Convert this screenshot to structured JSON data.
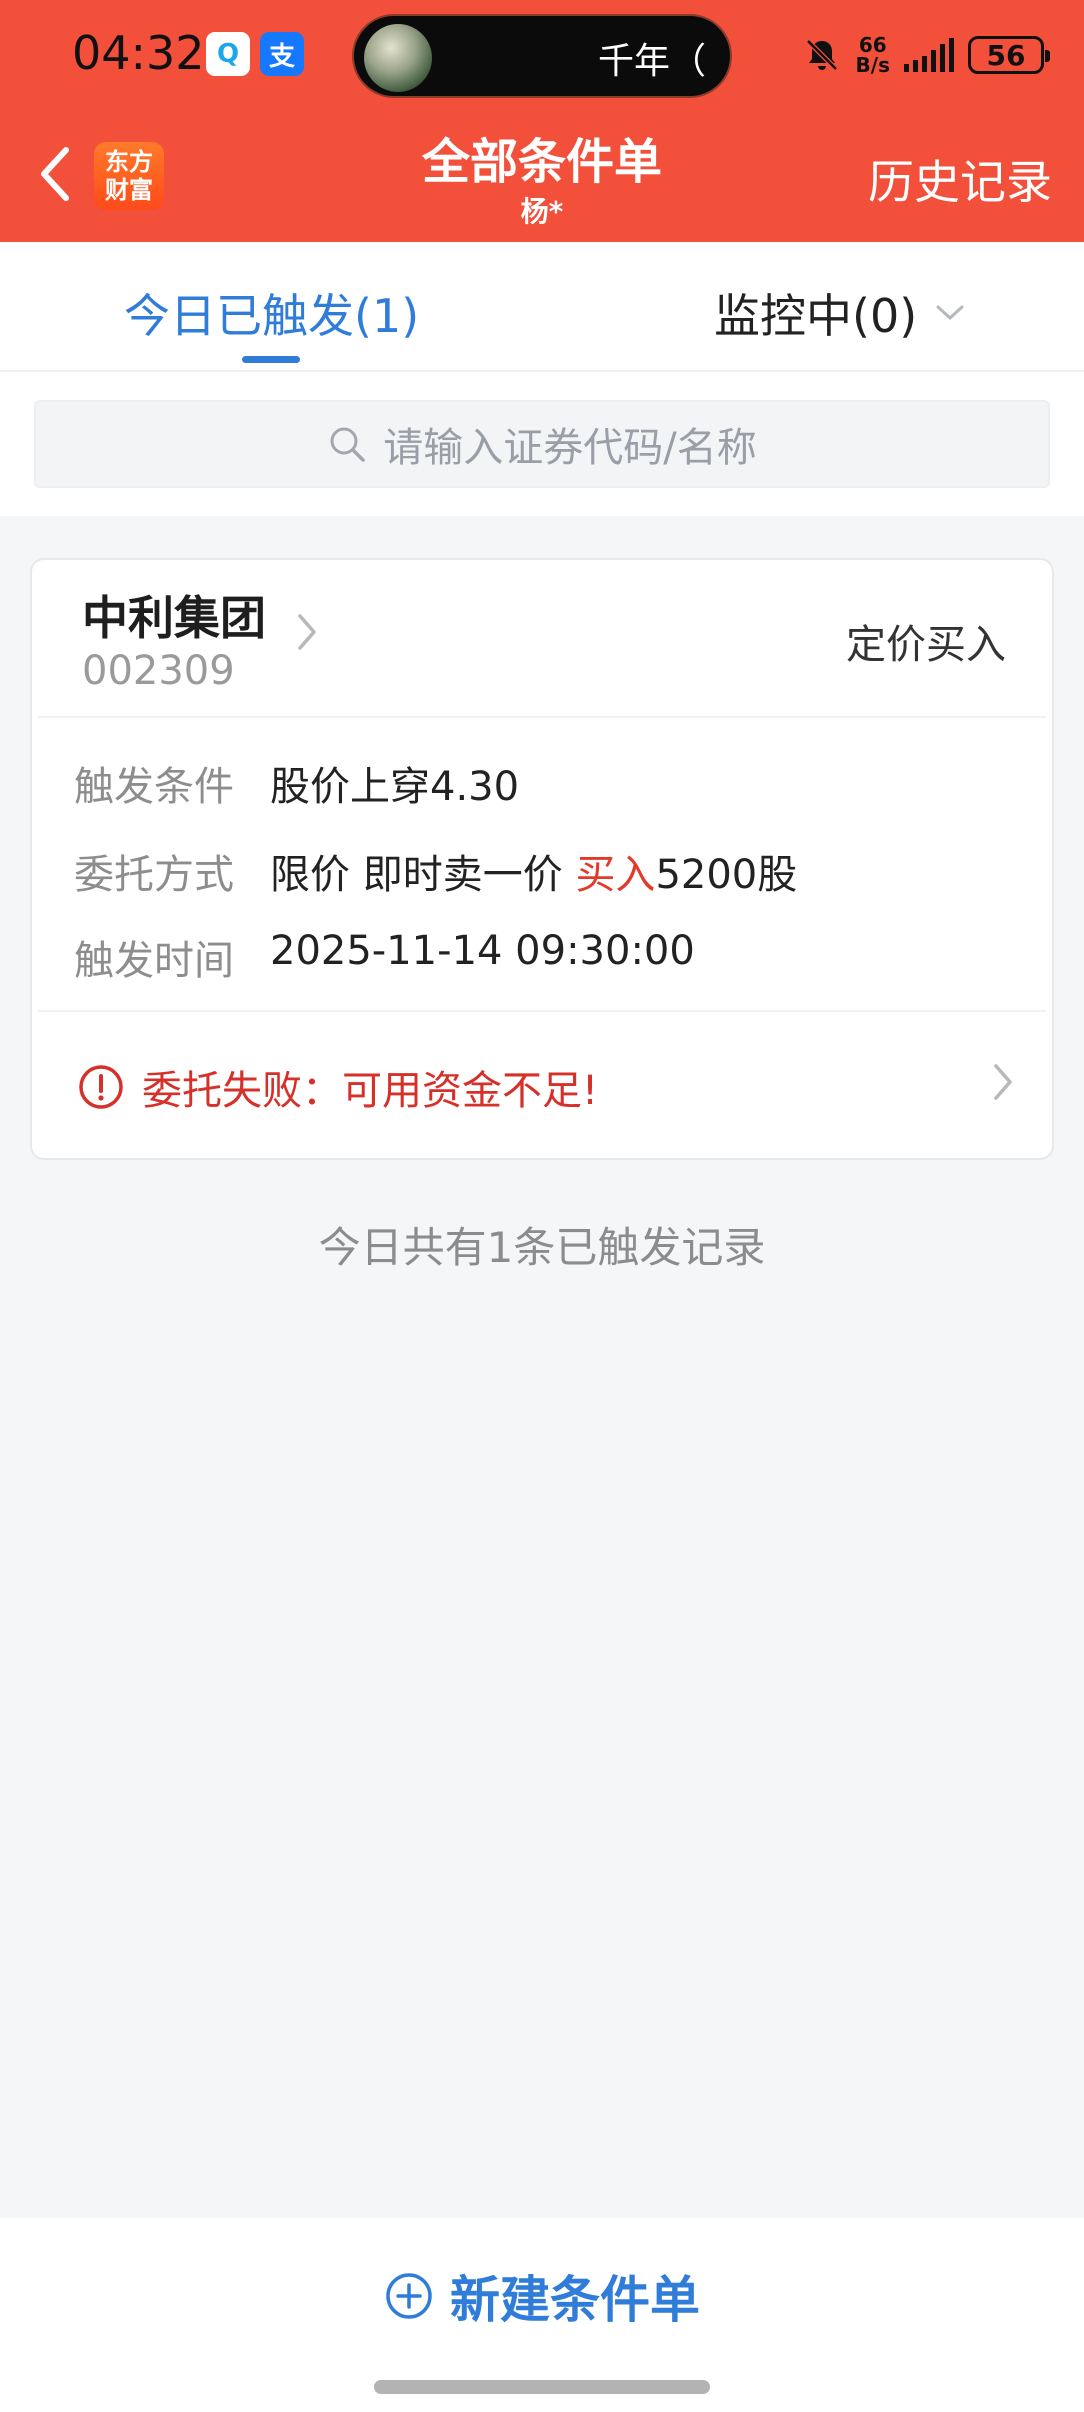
{
  "status_bar": {
    "time": "04:32",
    "qq_icon_glyph": "Q",
    "alipay_icon_glyph": "支",
    "island_text": "千年（",
    "net_speed_value": "66",
    "net_speed_unit": "B/s",
    "battery": "56"
  },
  "header": {
    "logo_line1": "东方",
    "logo_line2": "财富",
    "title": "全部条件单",
    "subtitle": "杨*",
    "history": "历史记录"
  },
  "tabs": {
    "triggered": "今日已触发(1)",
    "monitoring": "监控中(0)"
  },
  "search": {
    "placeholder": "请输入证券代码/名称"
  },
  "card": {
    "stock_name": "中利集团",
    "stock_code": "002309",
    "order_type": "定价买入",
    "rows": [
      {
        "label": "触发条件",
        "value": "股价上穿4.30"
      },
      {
        "label": "委托方式",
        "value_prefix": "限价 即时卖一价 ",
        "value_action": "买入",
        "value_suffix": "5200股"
      },
      {
        "label": "触发时间",
        "value": "2025-11-14 09:30:00"
      }
    ],
    "failure": "委托失败：可用资金不足!"
  },
  "summary": "今日共有1条已触发记录",
  "bottom": {
    "new_order": "新建条件单"
  },
  "colors": {
    "header_red": "#f2503a",
    "accent_blue": "#2f7cd9",
    "error_red": "#d6302a"
  }
}
